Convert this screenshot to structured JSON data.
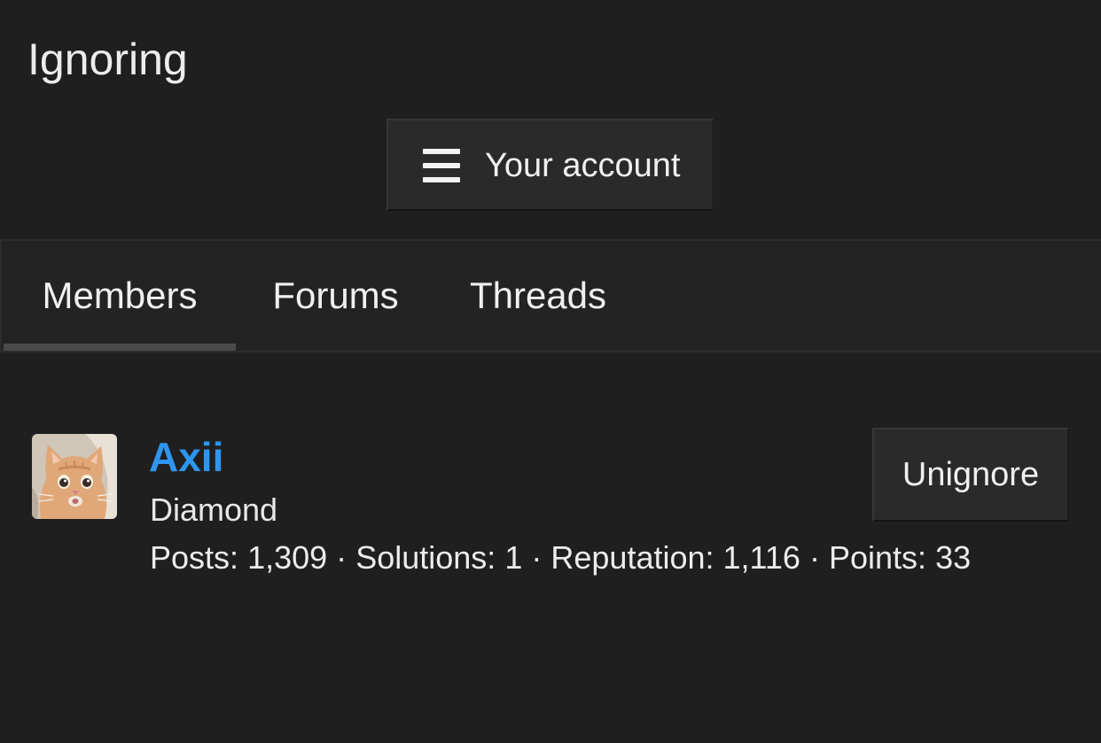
{
  "page": {
    "title": "Ignoring"
  },
  "account_menu": {
    "label": "Your account",
    "icon": "hamburger-icon"
  },
  "tabs": [
    {
      "label": "Members",
      "active": true
    },
    {
      "label": "Forums",
      "active": false
    },
    {
      "label": "Threads",
      "active": false
    }
  ],
  "members": [
    {
      "name": "Axii",
      "title": "Diamond",
      "avatar": "cat-avatar",
      "stats": {
        "posts_label": "Posts:",
        "posts": "1,309",
        "solutions_label": "Solutions:",
        "solutions": "1",
        "reputation_label": "Reputation:",
        "reputation": "1,116",
        "points_label": "Points:",
        "points": "33",
        "separator": "·"
      },
      "action_label": "Unignore"
    }
  ],
  "colors": {
    "background": "#1f1f1f",
    "link": "#2e95f0",
    "button_bg": "#2a2a2a",
    "tab_bar_bg": "#232323"
  }
}
